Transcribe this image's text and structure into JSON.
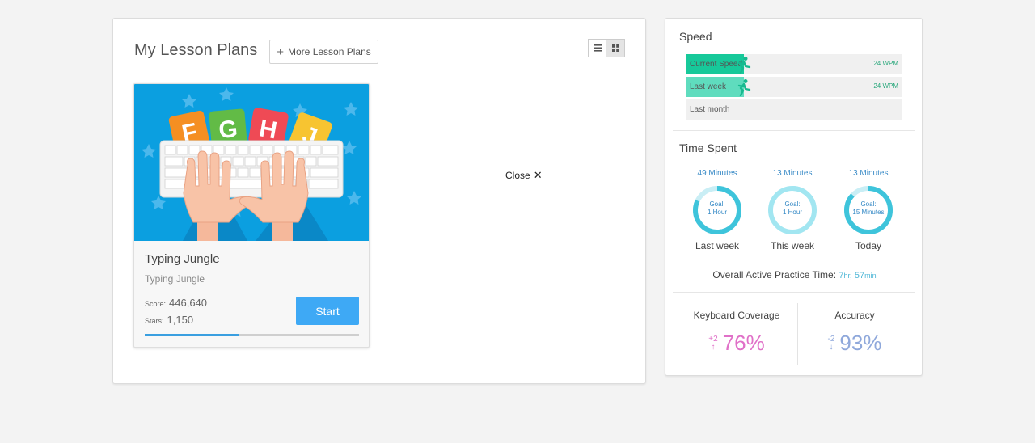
{
  "lesson_panel": {
    "title": "My Lesson Plans",
    "more_button": "More Lesson Plans",
    "close_label": "Close",
    "card": {
      "title": "Typing Jungle",
      "subtitle": "Typing Jungle",
      "score_label": "Score:",
      "score_value": "446,640",
      "stars_label": "Stars:",
      "stars_value": "1,150",
      "start_button": "Start",
      "progress_fraction": 0.44,
      "image_letters": [
        "F",
        "G",
        "H",
        "J"
      ]
    }
  },
  "stats_panel": {
    "speed": {
      "title": "Speed",
      "rows": [
        {
          "label": "Current Speed",
          "value": "24 WPM",
          "fill_fraction": 0.27,
          "color": "#17c99a"
        },
        {
          "label": "Last week",
          "value": "24 WPM",
          "fill_fraction": 0.27,
          "color": "#5fdcbe"
        },
        {
          "label": "Last month",
          "value": "",
          "fill_fraction": 0,
          "color": "#5fdcbe"
        }
      ]
    },
    "time_spent": {
      "title": "Time Spent",
      "rings": [
        {
          "minutes": "49 Minutes",
          "goal_label": "Goal:",
          "goal_value": "1 Hour",
          "period": "Last week",
          "progress": 0.82,
          "color": "#3ec4db"
        },
        {
          "minutes": "13 Minutes",
          "goal_label": "Goal:",
          "goal_value": "1 Hour",
          "period": "This week",
          "progress": 0.22,
          "color": "#a2e6f1"
        },
        {
          "minutes": "13 Minutes",
          "goal_label": "Goal:",
          "goal_value": "15 Minutes",
          "period": "Today",
          "progress": 0.87,
          "color": "#3ec4db"
        }
      ],
      "overall_label": "Overall Active Practice Time:",
      "overall_hours": "7",
      "overall_hours_unit": "hr,",
      "overall_minutes": "57",
      "overall_minutes_unit": "min"
    },
    "keyboard_coverage": {
      "title": "Keyboard Coverage",
      "delta": "+2",
      "value": "76%",
      "color": "#e070c8"
    },
    "accuracy": {
      "title": "Accuracy",
      "delta": "-2",
      "value": "93%",
      "color": "#8fa8db"
    }
  }
}
